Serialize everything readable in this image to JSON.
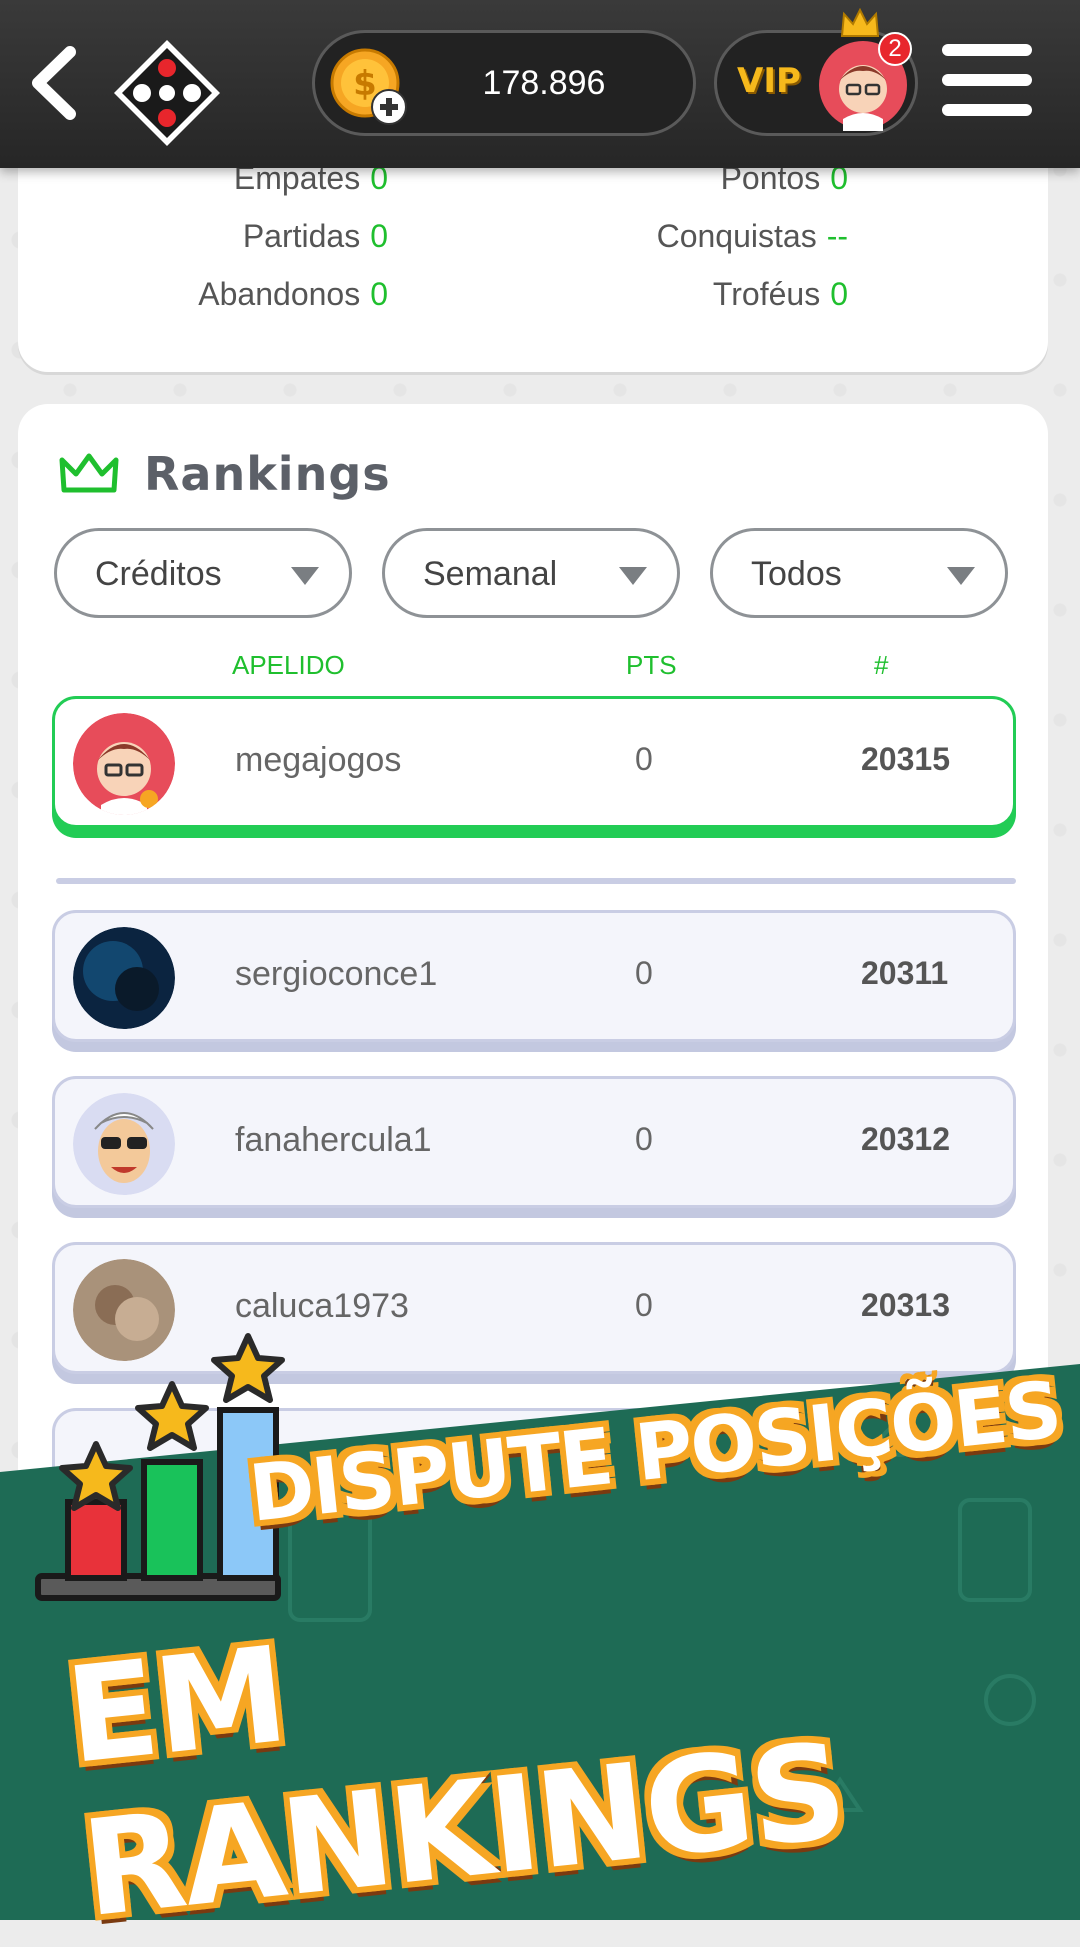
{
  "header": {
    "coins": "178.896",
    "vip_label": "VIP",
    "notifications": "2"
  },
  "stats": {
    "left": [
      {
        "label": "Empates",
        "value": "0"
      },
      {
        "label": "Partidas",
        "value": "0"
      },
      {
        "label": "Abandonos",
        "value": "0"
      }
    ],
    "right": [
      {
        "label": "Pontos",
        "value": "0"
      },
      {
        "label": "Conquistas",
        "value": "--"
      },
      {
        "label": "Troféus",
        "value": "0"
      }
    ]
  },
  "rankings": {
    "title": "Rankings",
    "filters": [
      "Créditos",
      "Semanal",
      "Todos"
    ],
    "columns": [
      "APELIDO",
      "PTS",
      "#"
    ],
    "me": {
      "name": "megajogos",
      "pts": "0",
      "pos": "20315"
    },
    "rows": [
      {
        "name": "sergioconce1",
        "pts": "0",
        "pos": "20311"
      },
      {
        "name": "fanahercula1",
        "pts": "0",
        "pos": "20312"
      },
      {
        "name": "caluca1973",
        "pts": "0",
        "pos": "20313"
      }
    ]
  },
  "promo": {
    "line1": "DISPUTE POSIÇÕES",
    "line2": "EM RANKINGS"
  },
  "colors": {
    "accent_green": "#1fbf2e",
    "banner_green": "#1e6b55",
    "vip_gold": "#f6b91c"
  }
}
